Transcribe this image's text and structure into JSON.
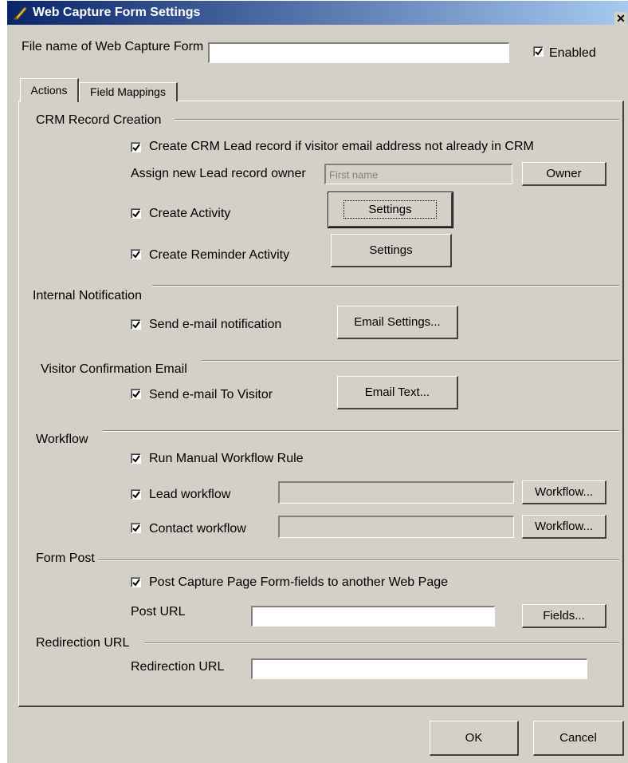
{
  "window": {
    "title": "Web Capture Form Settings",
    "close_glyph": "✕"
  },
  "header": {
    "filename_label": "File name of Web Capture Form",
    "filename_value": "",
    "enabled_label": "Enabled",
    "enabled_checked": true
  },
  "tabs": [
    {
      "label": "Actions",
      "selected": true
    },
    {
      "label": "Field Mappings",
      "selected": false
    }
  ],
  "crm": {
    "group_label": "CRM Record Creation",
    "create_lead_label": "Create CRM Lead record if visitor email address not already in CRM",
    "assign_owner_label": "Assign new Lead  record owner",
    "owner_placeholder": "First name",
    "owner_button": "Owner",
    "create_activity_label": "Create Activity",
    "create_activity_settings": "Settings",
    "create_reminder_label": "Create Reminder Activity",
    "create_reminder_settings": "Settings"
  },
  "internal": {
    "group_label": "Internal Notification",
    "send_label": "Send e-mail notification",
    "button": "Email Settings..."
  },
  "visitor": {
    "group_label": "Visitor Confirmation Email",
    "send_label": "Send e-mail To Visitor",
    "button": "Email Text..."
  },
  "workflow": {
    "group_label": "Workflow",
    "run_manual_label": "Run Manual Workflow Rule",
    "lead_label": "Lead workflow",
    "lead_button": "Workflow...",
    "contact_label": "Contact workflow",
    "contact_button": "Workflow..."
  },
  "form_post": {
    "group_label": "Form Post",
    "post_label": "Post Capture Page Form-fields to another Web Page",
    "post_url_label": "Post URL",
    "fields_button": "Fields..."
  },
  "redirection": {
    "group_label": "Redirection URL",
    "url_label": "Redirection URL"
  },
  "footer": {
    "ok": "OK",
    "cancel": "Cancel"
  },
  "colors": {
    "titlebar_start": "#0a246a",
    "titlebar_end": "#a6caf0",
    "face": "#d4d0c8"
  }
}
